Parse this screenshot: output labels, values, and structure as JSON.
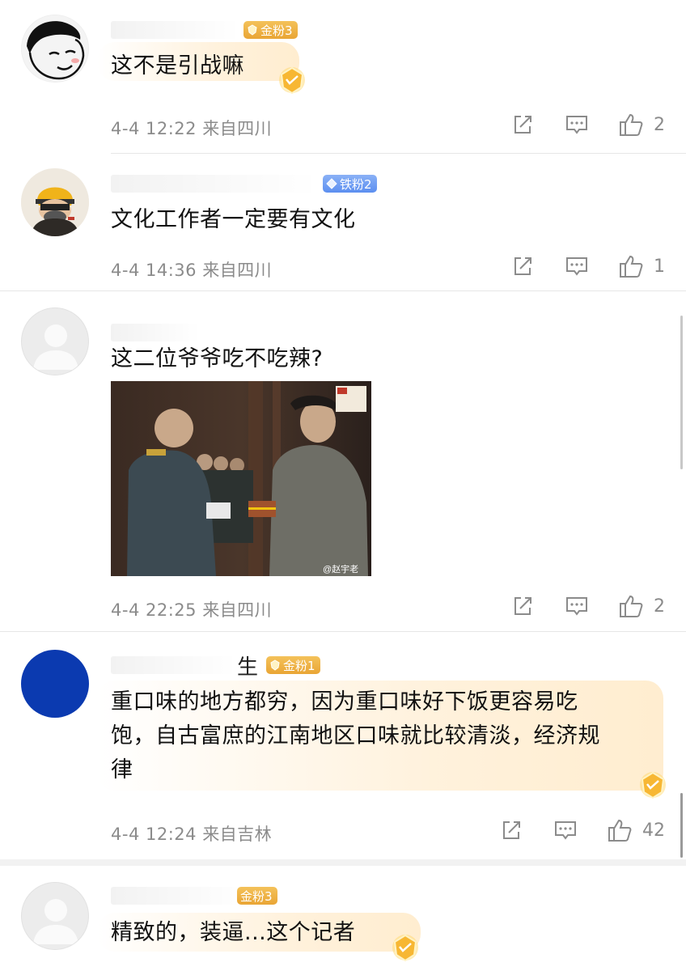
{
  "comments": [
    {
      "name_fragment": "",
      "badge": "金粉3",
      "text": "这不是引战嘛",
      "time": "4-4 12:22",
      "location": "来自四川",
      "likes": "2"
    },
    {
      "name_fragment": "",
      "badge": "铁粉2",
      "text": "文化工作者一定要有文化",
      "time": "4-4 14:36",
      "location": "来自四川",
      "likes": "1"
    },
    {
      "name_fragment": "",
      "badge": "",
      "text": "这二位爷爷吃不吃辣?",
      "image_watermark": "@赵宇老",
      "time": "4-4 22:25",
      "location": "来自四川",
      "likes": "2"
    },
    {
      "name_fragment": "生",
      "badge": "金粉1",
      "text": "重口味的地方都穷，因为重口味好下饭更容易吃饱，自古富庶的江南地区口味就比较清淡，经济规律",
      "text_lines": [
        "重口味的地方都穷，因为重口味好下饭更容易吃",
        "饱，自古富庶的江南地区口味就比较清淡，经济规",
        "律"
      ],
      "time": "4-4 12:24",
      "location": "来自吉林",
      "likes": "42"
    },
    {
      "name_fragment": "",
      "badge": "金粉3",
      "text": "精致的，装逼...这个记者"
    }
  ],
  "colors": {
    "gold_badge": "#e9a535",
    "iron_badge": "#5c8ff0",
    "meta_text": "#8b8b8b",
    "body_text": "#111111",
    "avatar_blue": "#0b3ab0"
  },
  "icons": [
    "share-icon",
    "comment-icon",
    "like-icon",
    "gold-gem-icon",
    "gold-badge-icon",
    "iron-badge-icon"
  ]
}
